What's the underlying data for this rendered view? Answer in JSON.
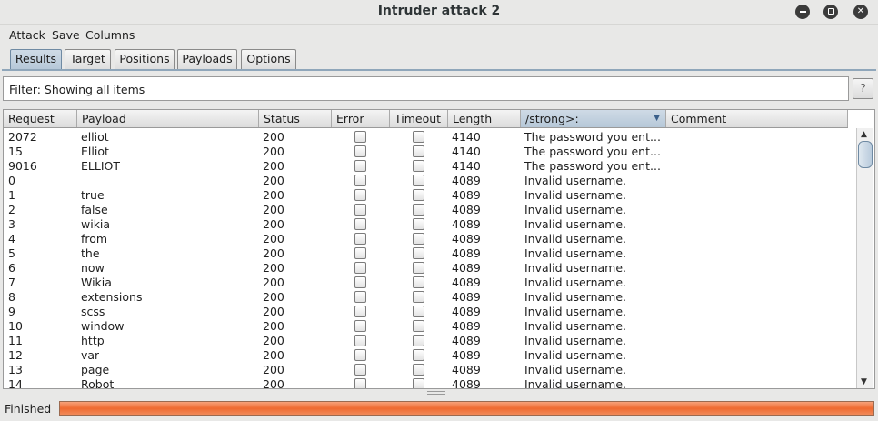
{
  "window": {
    "title": "Intruder attack 2"
  },
  "menu": [
    "Attack",
    "Save",
    "Columns"
  ],
  "tabs": [
    {
      "label": "Results",
      "active": true
    },
    {
      "label": "Target",
      "active": false
    },
    {
      "label": "Positions",
      "active": false
    },
    {
      "label": "Payloads",
      "active": false
    },
    {
      "label": "Options",
      "active": false
    }
  ],
  "filter": {
    "text": "Filter: Showing all items",
    "help": "?"
  },
  "table": {
    "columns": [
      "Request",
      "Payload",
      "Status",
      "Error",
      "Timeout",
      "Length",
      "/strong>:",
      "Comment"
    ],
    "sorted_column": "/strong>:",
    "rows": [
      {
        "request": "2072",
        "payload": "elliot",
        "status": "200",
        "length": "4140",
        "match": "The password you ent..."
      },
      {
        "request": "15",
        "payload": "Elliot",
        "status": "200",
        "length": "4140",
        "match": "The password you ent..."
      },
      {
        "request": "9016",
        "payload": "ELLIOT",
        "status": "200",
        "length": "4140",
        "match": "The password you ent..."
      },
      {
        "request": "0",
        "payload": "",
        "status": "200",
        "length": "4089",
        "match": "Invalid username."
      },
      {
        "request": "1",
        "payload": "true",
        "status": "200",
        "length": "4089",
        "match": "Invalid username."
      },
      {
        "request": "2",
        "payload": "false",
        "status": "200",
        "length": "4089",
        "match": "Invalid username."
      },
      {
        "request": "3",
        "payload": "wikia",
        "status": "200",
        "length": "4089",
        "match": "Invalid username."
      },
      {
        "request": "4",
        "payload": "from",
        "status": "200",
        "length": "4089",
        "match": "Invalid username."
      },
      {
        "request": "5",
        "payload": "the",
        "status": "200",
        "length": "4089",
        "match": "Invalid username."
      },
      {
        "request": "6",
        "payload": "now",
        "status": "200",
        "length": "4089",
        "match": "Invalid username."
      },
      {
        "request": "7",
        "payload": "Wikia",
        "status": "200",
        "length": "4089",
        "match": "Invalid username."
      },
      {
        "request": "8",
        "payload": "extensions",
        "status": "200",
        "length": "4089",
        "match": "Invalid username."
      },
      {
        "request": "9",
        "payload": "scss",
        "status": "200",
        "length": "4089",
        "match": "Invalid username."
      },
      {
        "request": "10",
        "payload": "window",
        "status": "200",
        "length": "4089",
        "match": "Invalid username."
      },
      {
        "request": "11",
        "payload": "http",
        "status": "200",
        "length": "4089",
        "match": "Invalid username."
      },
      {
        "request": "12",
        "payload": "var",
        "status": "200",
        "length": "4089",
        "match": "Invalid username."
      },
      {
        "request": "13",
        "payload": "page",
        "status": "200",
        "length": "4089",
        "match": "Invalid username."
      },
      {
        "request": "14",
        "payload": "Robot",
        "status": "200",
        "length": "4089",
        "match": "Invalid username."
      }
    ]
  },
  "status": {
    "label": "Finished",
    "progress": 1.0
  },
  "colors": {
    "progress": "#ef6a30",
    "active_tab": "#b6c8d8"
  }
}
